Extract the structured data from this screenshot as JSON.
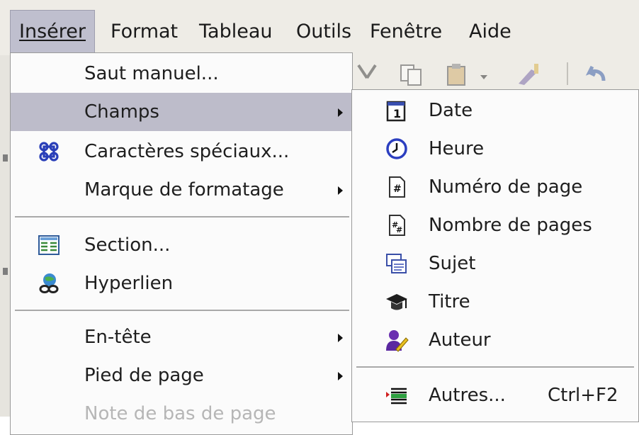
{
  "menubar": {
    "items": [
      {
        "label": "Insérer",
        "mnemonic": "I",
        "active": true
      },
      {
        "label": "Format",
        "mnemonic": "o"
      },
      {
        "label": "Tableau",
        "mnemonic": "a"
      },
      {
        "label": "Outils",
        "mnemonic": "t"
      },
      {
        "label": "Fenêtre",
        "mnemonic": "F"
      },
      {
        "label": "Aide",
        "mnemonic": "A"
      }
    ]
  },
  "insert_menu": {
    "items": [
      {
        "label": "Saut manuel...",
        "icon": null,
        "submenu": false
      },
      {
        "label": "Champs",
        "icon": null,
        "submenu": true,
        "highlighted": true
      },
      {
        "label": "Caractères spéciaux...",
        "icon": "special-characters-icon",
        "submenu": false
      },
      {
        "label": "Marque de formatage",
        "icon": null,
        "submenu": true
      },
      {
        "label": "Section...",
        "icon": "section-icon",
        "submenu": false
      },
      {
        "label": "Hyperlien",
        "icon": "hyperlink-icon",
        "submenu": false
      },
      {
        "label": "En-tête",
        "icon": null,
        "submenu": true
      },
      {
        "label": "Pied de page",
        "icon": null,
        "submenu": true
      },
      {
        "label": "Note de bas de page",
        "icon": null,
        "submenu": false,
        "disabled": true
      }
    ]
  },
  "fields_submenu": {
    "items": [
      {
        "label": "Date",
        "icon": "calendar-icon"
      },
      {
        "label": "Heure",
        "icon": "clock-icon"
      },
      {
        "label": "Numéro de page",
        "icon": "page-number-icon"
      },
      {
        "label": "Nombre de pages",
        "icon": "page-count-icon"
      },
      {
        "label": "Sujet",
        "icon": "subject-icon"
      },
      {
        "label": "Titre",
        "icon": "graduation-cap-icon"
      },
      {
        "label": "Auteur",
        "icon": "author-icon"
      },
      {
        "label": "Autres...",
        "icon": "other-fields-icon",
        "shortcut": "Ctrl+F2"
      }
    ]
  },
  "colors": {
    "menu_highlight": "#bdbcca",
    "menubar_bg": "#eeece6",
    "separator": "#a9a9a9",
    "disabled_text": "#b6b6b6"
  }
}
